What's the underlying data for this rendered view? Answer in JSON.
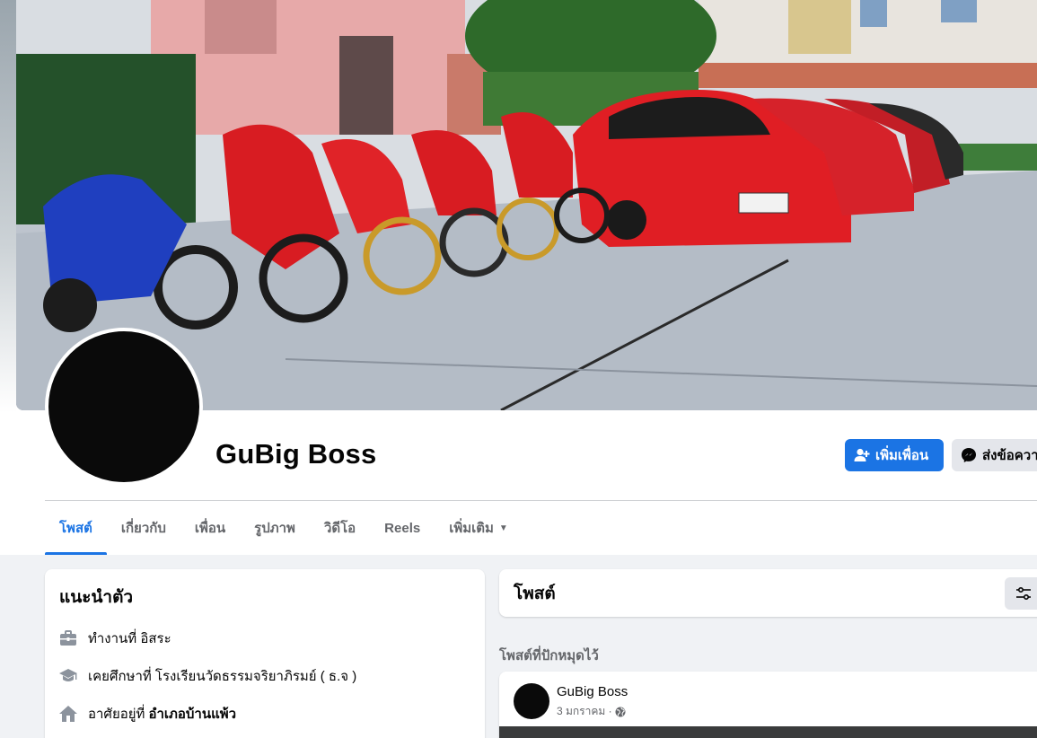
{
  "profile": {
    "name": "GuBig Boss",
    "add_friend_label": "เพิ่มเพื่อน",
    "message_label": "ส่งข้อควา"
  },
  "tabs": [
    {
      "label": "โพสต์",
      "active": true
    },
    {
      "label": "เกี่ยวกับ"
    },
    {
      "label": "เพื่อน"
    },
    {
      "label": "รูปภาพ"
    },
    {
      "label": "วิดีโอ"
    },
    {
      "label": "Reels"
    },
    {
      "label": "เพิ่มเติม"
    }
  ],
  "intro": {
    "title": "แนะนำตัว",
    "items": [
      {
        "icon": "briefcase-icon",
        "text": "ทำงานที่ อิสระ",
        "bold": ""
      },
      {
        "icon": "graduation-cap-icon",
        "text": "เคยศึกษาที่ โรงเรียนวัดธรรมจริยาภิรมย์ ( ธ.จ )",
        "bold": ""
      },
      {
        "icon": "home-icon",
        "text": "อาศัยอยู่ที่",
        "bold": "อำเภอบ้านแพ้ว"
      }
    ]
  },
  "posts": {
    "title": "โพสต์",
    "pinned_label": "โพสต์ที่ปักหมุดไว้",
    "pinned_post": {
      "author": "GuBig Boss",
      "date": "3 มกราคม ·"
    }
  },
  "colors": {
    "accent": "#1b74e4",
    "background": "#f0f2f5"
  }
}
